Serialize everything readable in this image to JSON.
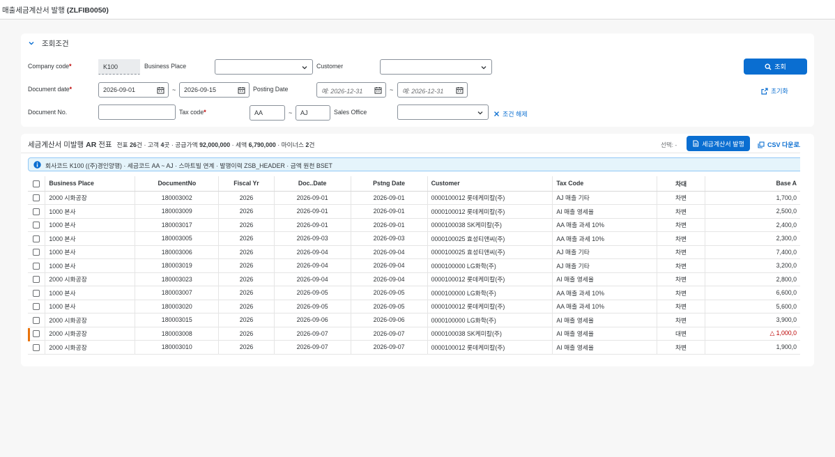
{
  "header": {
    "title": "매출세금계산서 발행",
    "code": "(ZLFIB0050)"
  },
  "filter": {
    "title": "조회조건",
    "company_code": {
      "label": "Company code",
      "value": "K100"
    },
    "business_place": {
      "label": "Business Place",
      "value": ""
    },
    "customer": {
      "label": "Customer",
      "value": ""
    },
    "document_date": {
      "label": "Document date",
      "from": "2026-09-01",
      "to": "2026-09-15"
    },
    "posting_date": {
      "label": "Posting Date",
      "from_placeholder": "예: 2026-12-31",
      "to_placeholder": "예: 2026-12-31"
    },
    "document_no": {
      "label": "Document No.",
      "value": ""
    },
    "tax_code": {
      "label": "Tax code",
      "from": "AA",
      "to": "AJ"
    },
    "sales_office": {
      "label": "Sales Office",
      "value": ""
    },
    "search_label": "조회",
    "reset_label": "초기화",
    "clear_label": "조건 해제",
    "tilde": "~"
  },
  "result": {
    "title_prefix": "세금계산서 미발행",
    "title_bold": "AR",
    "title_suffix": "전표",
    "summary": {
      "docs_label": "전표",
      "docs": "26",
      "docs_unit": "건 · 고객",
      "customers": "4",
      "customers_unit": "곳 · 공급가액",
      "supply": "92,000,000",
      "supply_unit": "· 세액",
      "tax": "6,790,000",
      "tax_unit": "· 마이너스",
      "minus": "2",
      "minus_unit": "건"
    },
    "selection": "선택: -",
    "issue_button": "세금계산서 발행",
    "csv_button": "CSV 다운로드",
    "info": "회사코드 K100 ((주)경인양행) · 세금코드 AA ~ AJ · 스마트빌 연계 · 발행이력 ZSB_HEADER · 금액 원천 BSET",
    "columns": [
      "Business Place",
      "DocumentNo",
      "Fiscal Yr",
      "Doc..Date",
      "Pstng Date",
      "Customer",
      "Tax Code",
      "차대",
      "Base A"
    ],
    "rows": [
      {
        "bp": "2000 시화공장",
        "doc": "180003002",
        "fy": "2026",
        "dd": "2026-09-01",
        "pd": "2026-09-01",
        "cust": "0000100012 롯데케미칼(주)",
        "tax": "AJ 매출 기타",
        "dc": "차변",
        "base": "1,700,0",
        "neg": false
      },
      {
        "bp": "1000 본사",
        "doc": "180003009",
        "fy": "2026",
        "dd": "2026-09-01",
        "pd": "2026-09-01",
        "cust": "0000100012 롯데케미칼(주)",
        "tax": "AI 매출 영세율",
        "dc": "차변",
        "base": "2,500,0",
        "neg": false
      },
      {
        "bp": "1000 본사",
        "doc": "180003017",
        "fy": "2026",
        "dd": "2026-09-01",
        "pd": "2026-09-01",
        "cust": "0000100038 SK케미칼(주)",
        "tax": "AA 매출 과세 10%",
        "dc": "차변",
        "base": "2,400,0",
        "neg": false
      },
      {
        "bp": "1000 본사",
        "doc": "180003005",
        "fy": "2026",
        "dd": "2026-09-03",
        "pd": "2026-09-03",
        "cust": "0000100025 효성티앤씨(주)",
        "tax": "AA 매출 과세 10%",
        "dc": "차변",
        "base": "2,300,0",
        "neg": false
      },
      {
        "bp": "1000 본사",
        "doc": "180003006",
        "fy": "2026",
        "dd": "2026-09-04",
        "pd": "2026-09-04",
        "cust": "0000100025 효성티앤씨(주)",
        "tax": "AJ 매출 기타",
        "dc": "차변",
        "base": "7,400,0",
        "neg": false
      },
      {
        "bp": "1000 본사",
        "doc": "180003019",
        "fy": "2026",
        "dd": "2026-09-04",
        "pd": "2026-09-04",
        "cust": "0000100000 LG화학(주)",
        "tax": "AJ 매출 기타",
        "dc": "차변",
        "base": "3,200,0",
        "neg": false
      },
      {
        "bp": "2000 시화공장",
        "doc": "180003023",
        "fy": "2026",
        "dd": "2026-09-04",
        "pd": "2026-09-04",
        "cust": "0000100012 롯데케미칼(주)",
        "tax": "AI 매출 영세율",
        "dc": "차변",
        "base": "2,800,0",
        "neg": false
      },
      {
        "bp": "1000 본사",
        "doc": "180003007",
        "fy": "2026",
        "dd": "2026-09-05",
        "pd": "2026-09-05",
        "cust": "0000100000 LG화학(주)",
        "tax": "AA 매출 과세 10%",
        "dc": "차변",
        "base": "6,600,0",
        "neg": false
      },
      {
        "bp": "1000 본사",
        "doc": "180003020",
        "fy": "2026",
        "dd": "2026-09-05",
        "pd": "2026-09-05",
        "cust": "0000100012 롯데케미칼(주)",
        "tax": "AA 매출 과세 10%",
        "dc": "차변",
        "base": "5,600,0",
        "neg": false
      },
      {
        "bp": "2000 시화공장",
        "doc": "180003015",
        "fy": "2026",
        "dd": "2026-09-06",
        "pd": "2026-09-06",
        "cust": "0000100000 LG화학(주)",
        "tax": "AI 매출 영세율",
        "dc": "차변",
        "base": "3,900,0",
        "neg": false
      },
      {
        "bp": "2000 시화공장",
        "doc": "180003008",
        "fy": "2026",
        "dd": "2026-09-07",
        "pd": "2026-09-07",
        "cust": "0000100038 SK케미칼(주)",
        "tax": "AI 매출 영세율",
        "dc": "대변",
        "base": "△ 1,000,0",
        "neg": true
      },
      {
        "bp": "2000 시화공장",
        "doc": "180003010",
        "fy": "2026",
        "dd": "2026-09-07",
        "pd": "2026-09-07",
        "cust": "0000100012 롯데케미칼(주)",
        "tax": "AI 매출 영세율",
        "dc": "차변",
        "base": "1,900,0",
        "neg": false
      }
    ]
  },
  "colors": {
    "accent": "#0a6ed1",
    "negative": "#bb0000",
    "row_marker": "#e9730c"
  }
}
